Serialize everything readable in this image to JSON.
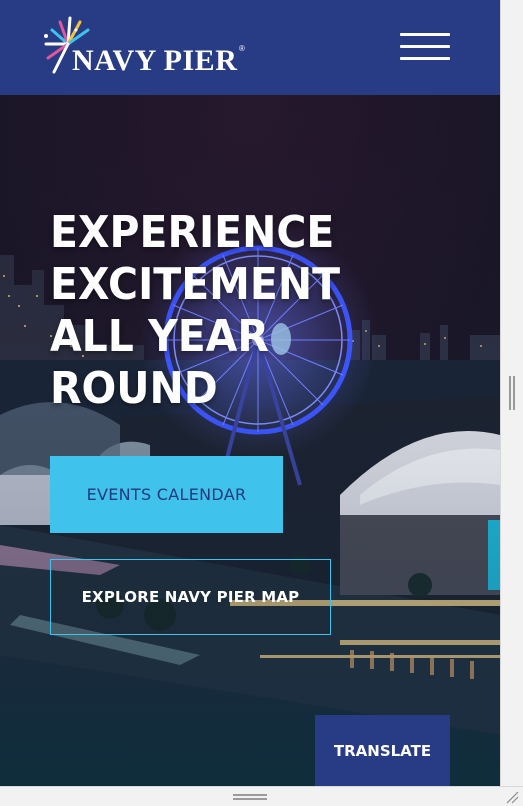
{
  "header": {
    "logo_text": "NAVY PIER",
    "logo_mark": "®",
    "logo_icon": "firework-burst-icon",
    "menu_icon": "hamburger-menu-icon"
  },
  "hero": {
    "headline_lines": [
      "EXPERIENCE",
      "EXCITEMENT",
      "ALL YEAR",
      "ROUND"
    ],
    "events_button": "EVENTS CALENDAR",
    "map_button": "EXPLORE NAVY PIER MAP",
    "translate_button": "TRANSLATE",
    "background": "night aerial view of Navy Pier with illuminated ferris wheel"
  },
  "colors": {
    "header_bg": "#283b85",
    "accent_cyan": "#3fc2ec",
    "events_text": "#213a7c",
    "translate_bg": "#283b85",
    "ferris_wheel": "#3b4cff"
  }
}
